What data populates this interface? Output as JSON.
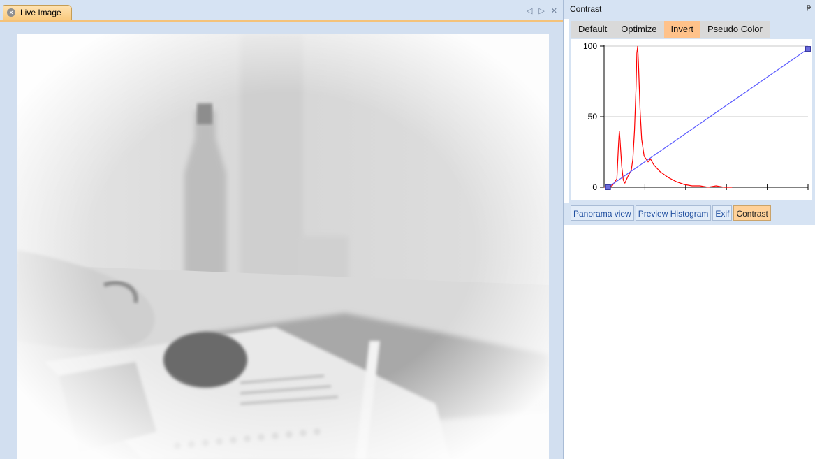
{
  "document": {
    "tab_label": "Live Image",
    "controls": {
      "left": "◁",
      "right": "▷",
      "close": "✕"
    }
  },
  "contrast_panel": {
    "title": "Contrast",
    "pin": "ᵽ",
    "modes": [
      {
        "label": "Default",
        "active": false
      },
      {
        "label": "Optimize",
        "active": false
      },
      {
        "label": "Invert",
        "active": true
      },
      {
        "label": "Pseudo Color",
        "active": false
      }
    ],
    "bottom_tabs": [
      {
        "label": "Panorama view",
        "active": false
      },
      {
        "label": "Preview Histogram",
        "active": false
      },
      {
        "label": "Exif",
        "active": false
      },
      {
        "label": "Contrast",
        "active": true
      }
    ]
  },
  "colors": {
    "histogram": "#ff0000",
    "curve": "#5a5aff",
    "active_tab": "#ffc28a",
    "panel": "#d6e3f3"
  },
  "chart_data": {
    "type": "line",
    "y_ticks": [
      "100",
      "50",
      "0"
    ],
    "ylim": [
      0,
      100
    ],
    "xlim": [
      0,
      255
    ],
    "grid": true,
    "series": [
      {
        "points": [
          [
            0,
            0
          ],
          [
            10,
            1
          ],
          [
            16,
            6
          ],
          [
            18,
            30
          ],
          [
            19,
            40
          ],
          [
            20,
            33
          ],
          [
            22,
            15
          ],
          [
            24,
            5
          ],
          [
            26,
            3
          ],
          [
            30,
            8
          ],
          [
            34,
            12
          ],
          [
            36,
            20
          ],
          [
            38,
            40
          ],
          [
            40,
            72
          ],
          [
            41,
            95
          ],
          [
            42,
            100
          ],
          [
            43,
            88
          ],
          [
            45,
            55
          ],
          [
            47,
            34
          ],
          [
            50,
            22
          ],
          [
            55,
            18
          ],
          [
            58,
            20
          ],
          [
            62,
            16
          ],
          [
            70,
            11
          ],
          [
            80,
            7
          ],
          [
            90,
            4
          ],
          [
            100,
            2
          ],
          [
            110,
            1
          ],
          [
            120,
            1
          ],
          [
            130,
            0
          ],
          [
            140,
            1
          ],
          [
            150,
            0
          ],
          [
            160,
            0
          ]
        ]
      },
      {
        "points": [
          [
            5,
            0
          ],
          [
            255,
            98
          ]
        ]
      }
    ]
  }
}
